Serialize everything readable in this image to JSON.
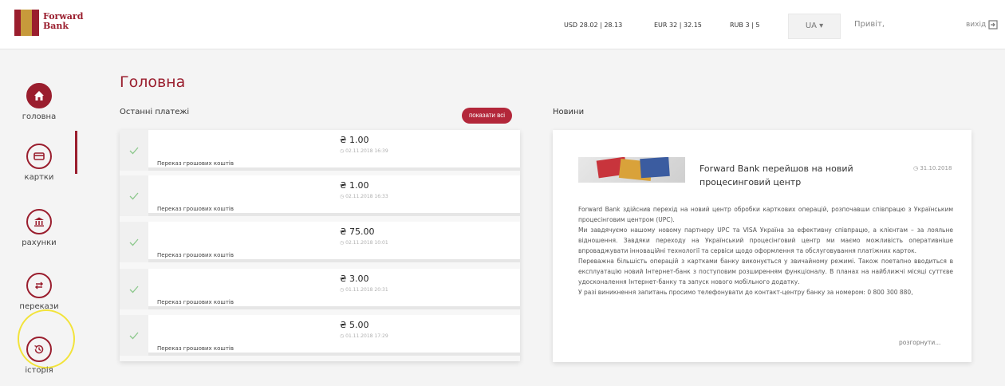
{
  "header": {
    "logo_text_line1": "Forward",
    "logo_text_line2": "Bank",
    "rates": [
      {
        "text": "USD  28.02 | 28.13"
      },
      {
        "text": "EUR  32 | 32.15"
      },
      {
        "text": "RUB  3 | 5"
      }
    ],
    "language": "UA ▾",
    "greeting": "Привіт,",
    "exit_label": "вихід"
  },
  "sidebar": {
    "items": [
      {
        "label": "головна"
      },
      {
        "label": "картки"
      },
      {
        "label": "рахунки"
      },
      {
        "label": "перекази"
      },
      {
        "label": "історія"
      }
    ]
  },
  "main": {
    "title": "Головна",
    "payments_label": "Останні платежі",
    "show_all_label": "показати всі",
    "news_label": "Новини"
  },
  "payments": [
    {
      "description": "Переказ грошових коштів",
      "amount": "₴ 1.00",
      "date": "◷ 02.11.2018 16:39"
    },
    {
      "description": "Переказ грошових коштів",
      "amount": "₴ 1.00",
      "date": "◷ 02.11.2018 16:33"
    },
    {
      "description": "Переказ грошових коштів",
      "amount": "₴ 75.00",
      "date": "◷ 02.11.2018 10:01"
    },
    {
      "description": "Переказ грошових коштів",
      "amount": "₴ 3.00",
      "date": "◷ 01.11.2018 20:31"
    },
    {
      "description": "Переказ грошових коштів",
      "amount": "₴ 5.00",
      "date": "◷ 01.11.2018 17:29"
    }
  ],
  "news": {
    "title": "Forward Bank перейшов на новий процесинговий центр",
    "date": "◷ 31.10.2018",
    "body": [
      "Forward Bank здійснив перехід на новий центр обробки карткових операцій, розпочавши співпрацю з Українським процесінговим центром (UPC).",
      "Ми завдячуємо нашому новому партнеру UPC та VISA Україна за ефективну співпрацю, а клієнтам – за лояльне відношення. Завдяки переходу на Український процесінговий центр ми маємо можливість оперативніше впроваджувати інноваційні технології та сервіси щодо оформлення та обслуговування платіжних карток.",
      "Переважна більшість операцій з картками банку виконується у звичайному режимі. Також поетапно вводиться в експлуатацію новий Інтернет-банк з поступовим розширенням функціоналу. В планах на найближчі місяці суттєве удосконалення Інтернет-банку та запуск нового мобільного додатку.",
      "У разі виникнення запитань просимо телефонувати до контакт-центру банку за номером: 0 800 300 880,"
    ],
    "more_label": "розгорнути..."
  },
  "colors": {
    "brand": "#9a1e2e",
    "accent_gold": "#c79a3b",
    "button": "#b3273a",
    "check": "#8cc88c",
    "highlight": "#f2e33a"
  }
}
